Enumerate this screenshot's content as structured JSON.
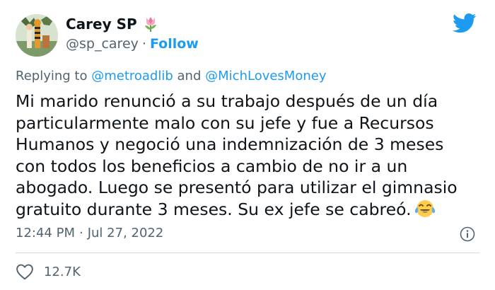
{
  "author": {
    "display_name": "Carey SP",
    "name_emoji": "tulip-emoji",
    "handle": "@sp_carey",
    "separator": "·",
    "follow_label": "Follow"
  },
  "reply": {
    "prefix": "Replying to",
    "mention_1": "@metroadlib",
    "conjunction": "and",
    "mention_2": "@MichLovesMoney"
  },
  "tweet": {
    "lines": [
      "Mi marido renunció a su trabajo después de un día",
      "particularmente malo con su jefe y fue a Recursos",
      "Humanos y negoció una indemnización de 3 meses",
      "con todos los beneficios a cambio de no ir a un",
      "abogado. Luego se presentó para utilizar el gimnasio",
      "gratuito durante 3 meses. Su ex jefe se cabreó."
    ],
    "trailing_emoji": "tears-of-joy-emoji"
  },
  "meta": {
    "time": "12:44 PM",
    "separator": "·",
    "date": "Jul 27, 2022"
  },
  "engagement": {
    "likes": "12.7K"
  },
  "colors": {
    "accent": "#1d9bf0",
    "secondary_text": "#536471",
    "primary_text": "#0f1419",
    "divider": "#cfd9de"
  },
  "icons": {
    "brand": "twitter-bird-icon",
    "info": "info-icon",
    "like": "heart-icon"
  }
}
